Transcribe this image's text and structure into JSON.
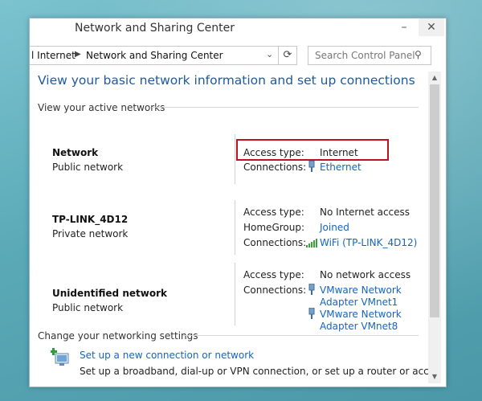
{
  "window": {
    "title": "Network and Sharing Center"
  },
  "address": {
    "crumbs": [
      "l Internet",
      "Network and Sharing Center"
    ]
  },
  "search": {
    "placeholder": "Search Control Panel"
  },
  "main": {
    "heading": "View your basic network information and set up connections",
    "active_section": "View your active networks",
    "labels": {
      "access_type": "Access type:",
      "connections": "Connections:",
      "homegroup": "HomeGroup:"
    },
    "networks": [
      {
        "name": "Network",
        "type": "Public network",
        "access": "Internet",
        "connections": [
          "Ethernet"
        ]
      },
      {
        "name": "TP-LINK_4D12",
        "type": "Private network",
        "access": "No Internet access",
        "homegroup": "Joined",
        "connections": [
          "WiFi (TP-LINK_4D12)"
        ]
      },
      {
        "name": "Unidentified network",
        "type": "Public network",
        "access": "No network access",
        "connections": [
          [
            "VMware Network",
            "Adapter VMnet1"
          ],
          [
            "VMware Network",
            "Adapter VMnet8"
          ]
        ]
      }
    ],
    "settings_section": "Change your networking settings",
    "setup": {
      "link": "Set up a new connection or network",
      "desc": "Set up a broadband, dial-up or VPN connection, or set up a router or access"
    }
  },
  "colors": {
    "link": "#1565c0",
    "heading": "#1e5a9c",
    "highlight": "#c0121e"
  }
}
